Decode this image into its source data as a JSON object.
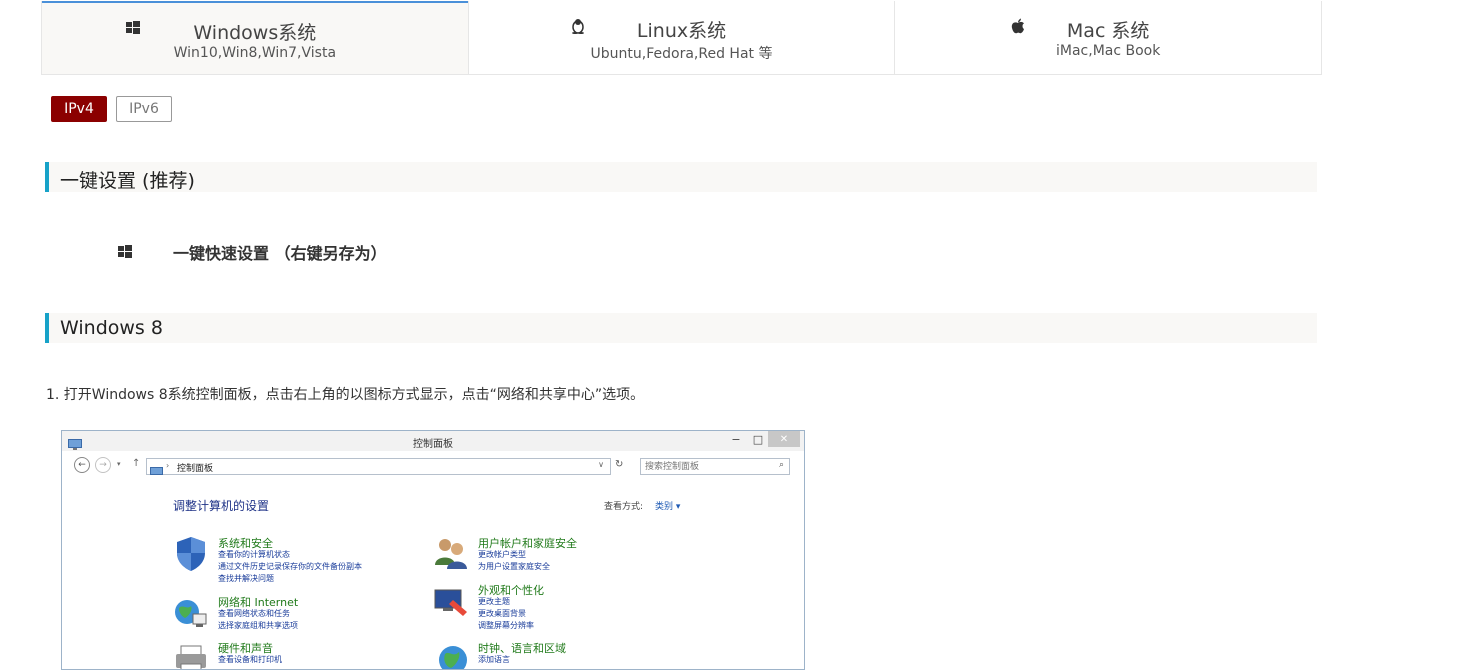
{
  "os_tabs": [
    {
      "icon": "windows-icon",
      "title": "Windows系统",
      "subtitle": "Win10,Win8,Win7,Vista",
      "active": true
    },
    {
      "icon": "linux-penguin-icon",
      "title": "Linux系统",
      "subtitle": "Ubuntu,Fedora,Red Hat 等",
      "active": false
    },
    {
      "icon": "apple-icon",
      "title": "Mac 系统",
      "subtitle": "iMac,Mac Book",
      "active": false
    }
  ],
  "ip_buttons": {
    "ipv4": "IPv4",
    "ipv6": "IPv6",
    "active": "IPv4"
  },
  "colors": {
    "accent_red": "#8b0000",
    "section_bar": "#17a2c8",
    "active_tab_line": "#4a90d9"
  },
  "section1": {
    "title": "一键设置 (推荐)"
  },
  "quick_setup": {
    "icon": "windows-icon",
    "label": "一键快速设置 （右键另存为）"
  },
  "section2": {
    "title": "Windows 8"
  },
  "steps": [
    "1. 打开Windows 8系统控制面板，点击右上角的以图标方式显示，点击“网络和共享中心”选项。"
  ],
  "control_panel": {
    "window_title": "控制面板",
    "address": "控制面板",
    "search_placeholder": "搜索控制面板",
    "heading": "调整计算机的设置",
    "view_label": "查看方式:",
    "view_value": "类别 ▾",
    "categories_left": [
      {
        "icon": "shield-icon",
        "title": "系统和安全",
        "links": [
          "查看你的计算机状态",
          "通过文件历史记录保存你的文件备份副本",
          "查找并解决问题"
        ]
      },
      {
        "icon": "network-globe-icon",
        "title": "网络和 Internet",
        "links": [
          "查看网络状态和任务",
          "选择家庭组和共享选项"
        ]
      },
      {
        "icon": "printer-icon",
        "title": "硬件和声音",
        "links": [
          "查看设备和打印机"
        ]
      }
    ],
    "categories_right": [
      {
        "icon": "users-icon",
        "title": "用户帐户和家庭安全",
        "links": [
          "更改帐户类型",
          "为用户设置家庭安全"
        ]
      },
      {
        "icon": "display-paint-icon",
        "title": "外观和个性化",
        "links": [
          "更改主题",
          "更改桌面背景",
          "调整屏幕分辨率"
        ]
      },
      {
        "icon": "clock-globe-icon",
        "title": "时钟、语言和区域",
        "links": [
          "添加语言"
        ]
      }
    ]
  }
}
